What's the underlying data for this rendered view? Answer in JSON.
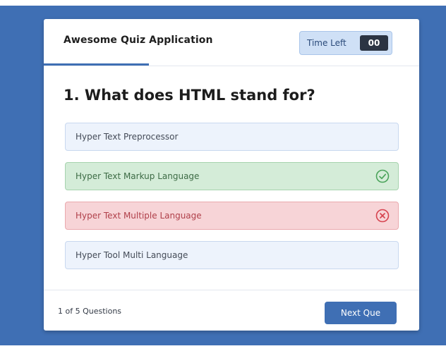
{
  "app": {
    "title": "Awesome Quiz Application"
  },
  "timer": {
    "label": "Time Left",
    "value": "00"
  },
  "progress": {
    "fraction": 0.28
  },
  "question": {
    "text": "1. What does HTML stand for?"
  },
  "options": [
    {
      "text": "Hyper Text Preprocessor",
      "state": "neutral"
    },
    {
      "text": "Hyper Text Markup Language",
      "state": "correct",
      "icon": "check-circle-icon"
    },
    {
      "text": "Hyper Text Multiple Language",
      "state": "incorrect",
      "icon": "cross-circle-icon"
    },
    {
      "text": "Hyper Tool Multi Language",
      "state": "neutral"
    }
  ],
  "footer": {
    "counter": "1 of 5 Questions",
    "next_label": "Next Que"
  },
  "colors": {
    "accent": "#3f6fb4",
    "correct": "#4aa35a",
    "incorrect": "#d6434f"
  }
}
